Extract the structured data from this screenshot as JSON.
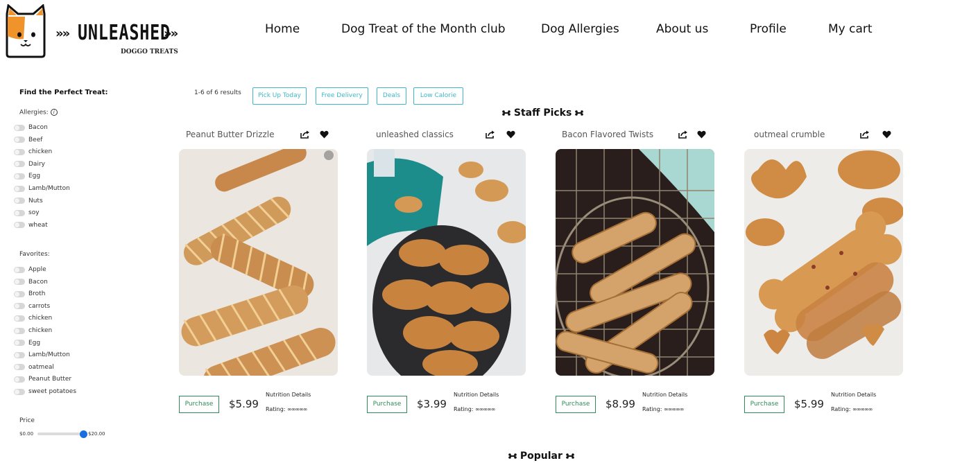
{
  "brand": {
    "name": "UNLEASHED",
    "arrows": "»»",
    "tagline": "DOGGO TREATS",
    "icon": "cat-face-logo-icon"
  },
  "nav": {
    "items": [
      {
        "label": "Home"
      },
      {
        "label": "Dog Treat of the Month club"
      },
      {
        "label": "Dog Allergies"
      },
      {
        "label": "About us"
      },
      {
        "label": "Profile"
      },
      {
        "label": "My cart"
      }
    ]
  },
  "sidebar": {
    "title": "Find the Perfect Treat:",
    "allergies_label": "Allergies:",
    "allergies_info_icon": "info-icon",
    "allergies": [
      "Bacon",
      "Beef",
      "chicken",
      "Dairy",
      "Egg",
      "Lamb/Mutton",
      "Nuts",
      "soy",
      "wheat"
    ],
    "favorites_label": "Favorites:",
    "favorites": [
      "Apple",
      "Bacon",
      "Broth",
      "carrots",
      "chicken",
      "chicken",
      "Egg",
      "Lamb/Mutton",
      "oatmeal",
      "Peanut Butter",
      "sweet potatoes"
    ],
    "price_label": "Price",
    "price_min": "$0.00",
    "price_max": "$20.00",
    "price_slider_value_fraction": 1.0
  },
  "results": {
    "count_text": "1-6 of 6 results",
    "chips": [
      "Pick Up Today",
      "Free Delivery",
      "Deals",
      "Low Calorie"
    ]
  },
  "sections": {
    "staff_picks": "Staff Picks",
    "popular": "Popular",
    "bone_icon": "bone-icon"
  },
  "products": [
    {
      "name": "Peanut Butter Drizzle",
      "price": "$5.99",
      "purchase_label": "Purchase",
      "nutrition_label": "Nutrition Details",
      "rating_label": "Rating:",
      "rating_icons": "∞∞∞∞∞",
      "image": "peanut-butter-drizzle-bones"
    },
    {
      "name": "unleashed classics",
      "price": "$3.99",
      "purchase_label": "Purchase",
      "nutrition_label": "Nutrition Details",
      "rating_label": "Rating:",
      "rating_icons": "∞∞∞∞∞",
      "image": "classic-bone-biscuits-bowl"
    },
    {
      "name": "Bacon Flavored Twists",
      "price": "$8.99",
      "purchase_label": "Purchase",
      "nutrition_label": "Nutrition Details",
      "rating_label": "Rating:",
      "rating_icons": "∞∞∞∞∞",
      "image": "twisted-treats-basket"
    },
    {
      "name": "outmeal crumble",
      "price": "$5.99",
      "purchase_label": "Purchase",
      "nutrition_label": "Nutrition Details",
      "rating_label": "Rating:",
      "rating_icons": "∞∞∞∞∞",
      "image": "oatmeal-crumble-bones"
    }
  ],
  "colors": {
    "chip": "#3cb8c9",
    "purchase": "#2e8b57",
    "slider": "#1a6fe0"
  }
}
